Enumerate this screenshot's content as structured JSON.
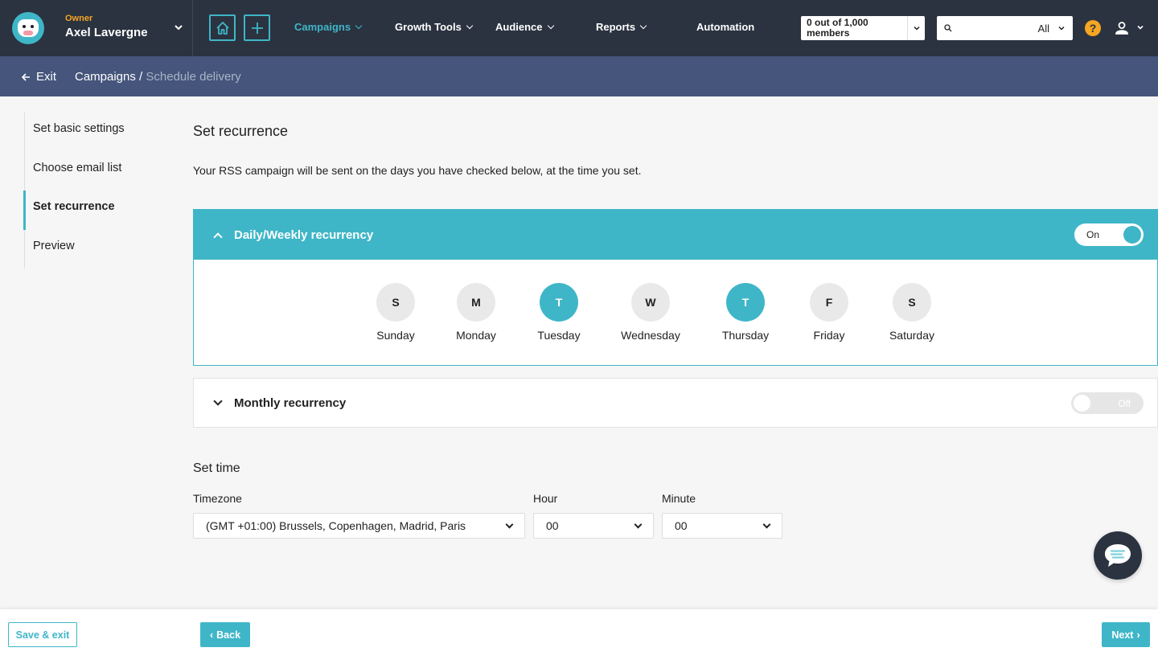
{
  "topnav": {
    "owner_role": "Owner",
    "owner_name": "Axel Lavergne",
    "nav": [
      {
        "label": "Campaigns",
        "active": true
      },
      {
        "label": "Growth Tools",
        "active": false
      },
      {
        "label": "Audience",
        "active": false
      },
      {
        "label": "Reports",
        "active": false
      },
      {
        "label": "Automation",
        "active": false
      }
    ],
    "members_text": "0 out of 1,000 members",
    "search_value": "",
    "search_scope": "All",
    "help_label": "?"
  },
  "subbar": {
    "exit_label": "Exit",
    "breadcrumb_root": "Campaigns",
    "breadcrumb_sep": "/",
    "breadcrumb_current": "Schedule delivery"
  },
  "steps": [
    {
      "label": "Set basic settings",
      "active": false
    },
    {
      "label": "Choose email list",
      "active": false
    },
    {
      "label": "Set recurrence",
      "active": true
    },
    {
      "label": "Preview",
      "active": false
    }
  ],
  "main": {
    "title": "Set recurrence",
    "description": "Your RSS campaign will be sent on the days you have checked below, at the time you set.",
    "weekly": {
      "title": "Daily/Weekly recurrency",
      "toggle_label": "On",
      "days": [
        {
          "letter": "S",
          "label": "Sunday",
          "checked": false
        },
        {
          "letter": "M",
          "label": "Monday",
          "checked": false
        },
        {
          "letter": "T",
          "label": "Tuesday",
          "checked": true
        },
        {
          "letter": "W",
          "label": "Wednesday",
          "checked": false
        },
        {
          "letter": "T",
          "label": "Thursday",
          "checked": true
        },
        {
          "letter": "F",
          "label": "Friday",
          "checked": false
        },
        {
          "letter": "S",
          "label": "Saturday",
          "checked": false
        }
      ]
    },
    "monthly": {
      "title": "Monthly recurrency",
      "toggle_label": "Off"
    },
    "time": {
      "title": "Set time",
      "timezone_label": "Timezone",
      "timezone_value": "(GMT +01:00) Brussels, Copenhagen, Madrid, Paris",
      "hour_label": "Hour",
      "hour_value": "00",
      "minute_label": "Minute",
      "minute_value": "00"
    }
  },
  "footer": {
    "save_exit": "Save & exit",
    "back": "Back",
    "next": "Next"
  },
  "colors": {
    "accent": "#3fb6c8",
    "nav_bg": "#2b3340",
    "subbar_bg": "#45557b",
    "help": "#f6a623"
  }
}
